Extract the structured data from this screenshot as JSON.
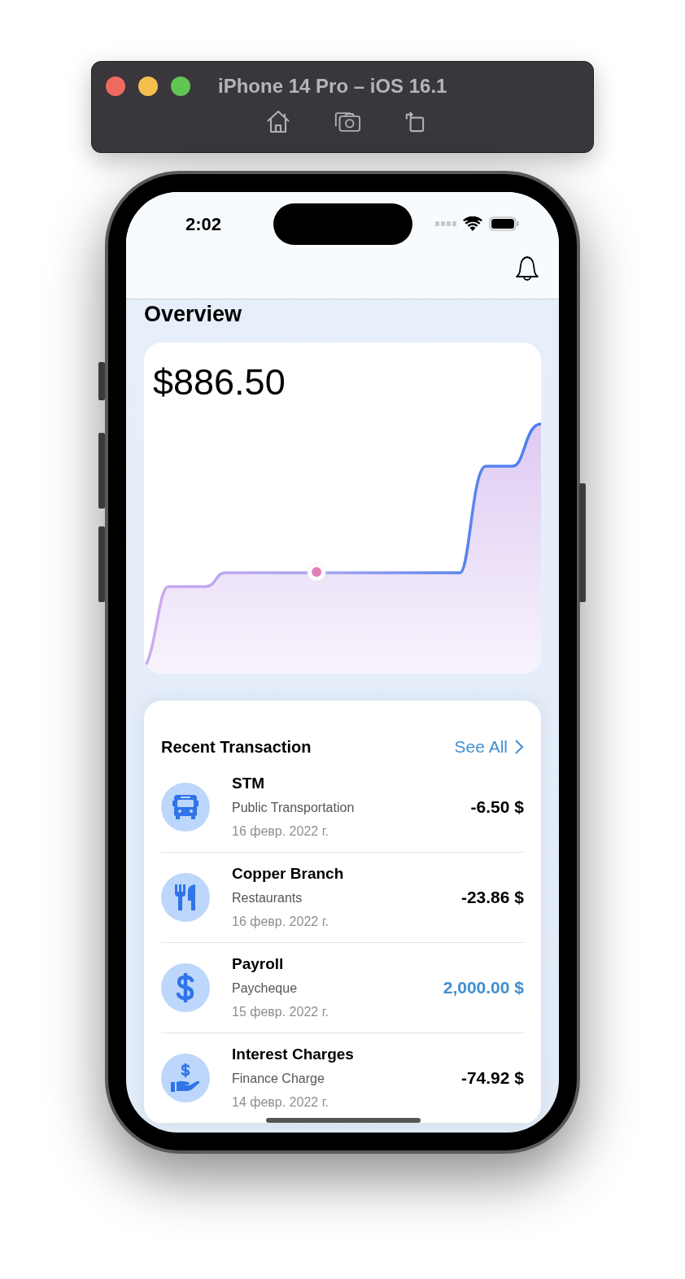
{
  "window": {
    "title": "iPhone 14 Pro – iOS 16.1"
  },
  "status_bar": {
    "time": "2:02"
  },
  "page": {
    "title": "Overview"
  },
  "balance": {
    "amount": "$886.50"
  },
  "transactions": {
    "title": "Recent Transaction",
    "see_all": "See All",
    "items": [
      {
        "kind": "bus",
        "name": "STM",
        "category": "Public Transportation",
        "date": "16 февр. 2022 г.",
        "amount": "-6.50 $",
        "income": false
      },
      {
        "kind": "food",
        "name": "Copper Branch",
        "category": "Restaurants",
        "date": "16 февр. 2022 г.",
        "amount": "-23.86 $",
        "income": false
      },
      {
        "kind": "dollar",
        "name": "Payroll",
        "category": "Paycheque",
        "date": "15 февр. 2022 г.",
        "amount": "2,000.00 $",
        "income": true
      },
      {
        "kind": "hand",
        "name": "Interest Charges",
        "category": "Finance Charge",
        "date": "14 февр. 2022 г.",
        "amount": "-74.92 $",
        "income": false
      }
    ]
  }
}
